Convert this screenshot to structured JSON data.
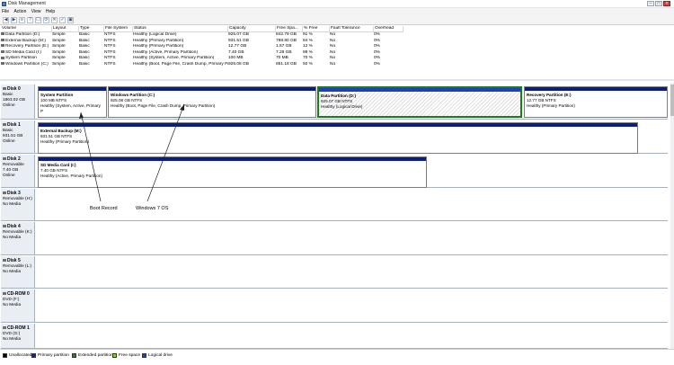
{
  "window": {
    "title": "Disk Management",
    "controls": {
      "minimize": "–",
      "maximize": "□",
      "close": "×"
    }
  },
  "menu": [
    {
      "label": "File"
    },
    {
      "label": "Action"
    },
    {
      "label": "View"
    },
    {
      "label": "Help"
    }
  ],
  "toolbar": {
    "buttons": [
      {
        "icon": "back-icon",
        "glyph": "◀"
      },
      {
        "icon": "forward-icon",
        "glyph": "▶"
      },
      {
        "icon": "details-icon",
        "glyph": "≡"
      },
      {
        "icon": "help-icon",
        "glyph": "?"
      },
      {
        "icon": "properties-icon",
        "glyph": "☐"
      },
      {
        "icon": "refresh-icon",
        "glyph": "⟳"
      },
      {
        "icon": "delete-icon",
        "glyph": "✕"
      },
      {
        "icon": "check-icon",
        "glyph": "✓"
      },
      {
        "icon": "view-icon",
        "glyph": "▣"
      }
    ]
  },
  "volume_table": {
    "columns": [
      "Volume",
      "Layout",
      "Type",
      "File System",
      "Status",
      "Capacity",
      "Free Spa...",
      "% Free",
      "Fault Tolerance",
      "Overhead"
    ],
    "rows": [
      [
        "Data Partition (D:)",
        "Simple",
        "Basic",
        "NTFS",
        "Healthy (Logical Drive)",
        "925.07 GB",
        "842.79 GB",
        "91 %",
        "No",
        "0%"
      ],
      [
        "External Backup (M:)",
        "Simple",
        "Basic",
        "NTFS",
        "Healthy (Primary Partition)",
        "931.51 GB",
        "788.80 GB",
        "84 %",
        "No",
        "0%"
      ],
      [
        "Recovery Partition (E:)",
        "Simple",
        "Basic",
        "NTFS",
        "Healthy (Primary Partition)",
        "12.77 GB",
        "1.57 GB",
        "12 %",
        "No",
        "0%"
      ],
      [
        "SD Media Card (I:)",
        "Simple",
        "Basic",
        "NTFS",
        "Healthy (Active, Primary Partition)",
        "7.40 GB",
        "7.28 GB",
        "98 %",
        "No",
        "0%"
      ],
      [
        "System Partition",
        "Simple",
        "Basic",
        "NTFS",
        "Healthy (System, Active, Primary Partition)",
        "100 MB",
        "70 MB",
        "70 %",
        "No",
        "0%"
      ],
      [
        "Windows Partition (C:)",
        "Simple",
        "Basic",
        "NTFS",
        "Healthy (Boot, Page File, Crash Dump, Primary Partition)",
        "925.08 GB",
        "851.18 GB",
        "92 %",
        "No",
        "0%"
      ]
    ]
  },
  "disks": [
    {
      "name": "Disk 0",
      "meta": [
        "Basic",
        "1863.02 GB",
        "Online"
      ],
      "partitions": [
        {
          "name": "System Partition",
          "size": "100 MB NTFS",
          "status": "Healthy (System, Active, Primary P",
          "kind": "primary"
        },
        {
          "name": "Windows Partition (C:)",
          "size": "925.08 GB NTFS",
          "status": "Healthy (Boot, Page File, Crash Dump, Primary Partition)",
          "kind": "primary"
        },
        {
          "name": "Data Partition (D:)",
          "size": "925.07 GB NTFS",
          "status": "Healthy (Logical Drive)",
          "kind": "logical"
        },
        {
          "name": "Recovery Partition (E:)",
          "size": "12.77 GB NTFS",
          "status": "Healthy (Primary Partition)",
          "kind": "primary"
        }
      ]
    },
    {
      "name": "Disk 1",
      "meta": [
        "Basic",
        "931.51 GB",
        "Online"
      ],
      "partitions": [
        {
          "name": "External Backup (M:)",
          "size": "931.51 GB NTFS",
          "status": "Healthy (Primary Partition)",
          "kind": "primary"
        }
      ]
    },
    {
      "name": "Disk 2",
      "meta": [
        "Removable",
        "7.40 GB",
        "Online"
      ],
      "partitions": [
        {
          "name": "SD Media Card (I:)",
          "size": "7.40 GB NTFS",
          "status": "Healthy (Active, Primary Partition)",
          "kind": "primary"
        }
      ]
    },
    {
      "name": "Disk 3",
      "meta": [
        "Removable (H:)",
        "",
        "No Media"
      ],
      "partitions": []
    },
    {
      "name": "Disk 4",
      "meta": [
        "Removable (K:)",
        "",
        "No Media"
      ],
      "partitions": []
    },
    {
      "name": "Disk 5",
      "meta": [
        "Removable (L:)",
        "",
        "No Media"
      ],
      "partitions": []
    },
    {
      "name": "CD-ROM 0",
      "meta": [
        "DVD (F:)",
        "",
        "No Media"
      ],
      "partitions": []
    },
    {
      "name": "CD-ROM 1",
      "meta": [
        "DVD (G:)",
        "",
        "No Media"
      ],
      "partitions": []
    }
  ],
  "annotations": [
    {
      "text": "Boot Record"
    },
    {
      "text": "Windows 7 OS"
    }
  ],
  "legend": [
    {
      "label": "Unallocated",
      "color": "#000000"
    },
    {
      "label": "Primary partition",
      "color": "#1a237e"
    },
    {
      "label": "Extended partition",
      "color": "#2e7d32"
    },
    {
      "label": "Free space",
      "color": "#7fd13b"
    },
    {
      "label": "Logical drive",
      "color": "#1f3fbf"
    }
  ],
  "colors": {
    "primary": "#0a1b8a",
    "logical": "#1f3fbf",
    "selected": "#1f7a1f"
  }
}
